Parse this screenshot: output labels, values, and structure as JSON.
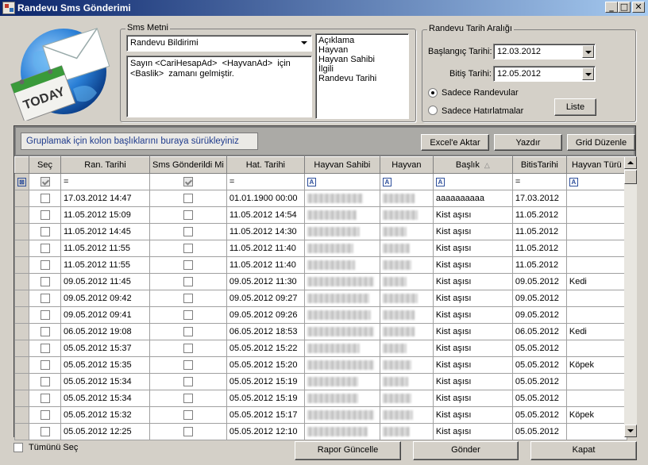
{
  "window": {
    "title": "Randevu Sms Gönderimi"
  },
  "sms": {
    "group_title": "Sms Metni",
    "template_selected": "Randevu Bildirimi",
    "message_text": "Sayın <CariHesapAd>  <HayvanAd>  için <Baslik>  zamanı gelmiştir.",
    "fields": [
      "Açıklama",
      "Hayvan",
      "Hayvan Sahibi",
      "İlgili",
      "Randevu Tarihi"
    ]
  },
  "date_range": {
    "group_title": "Randevu Tarih Aralığı",
    "start_label": "Başlangıç Tarihi:",
    "start_value": "12.03.2012",
    "end_label": "Bitiş Tarihi:",
    "end_value": "12.05.2012",
    "radio_appointments": "Sadece Randevular",
    "radio_reminders": "Sadece Hatırlatmalar",
    "selected": "appointments",
    "list_button": "Liste"
  },
  "toolbar": {
    "group_hint": "Gruplamak için kolon başlıklarını buraya sürükleyiniz",
    "excel_button": "Excel'e Aktar",
    "print_button": "Yazdır",
    "grid_button": "Grid Düzenle"
  },
  "grid": {
    "columns": [
      "Seç",
      "Ran. Tarihi",
      "Sms Gönderildi Mi",
      "Hat. Tarihi",
      "Hayvan Sahibi",
      "Hayvan",
      "Başlık",
      "BitisTarihi",
      "Hayvan Türü"
    ],
    "filter_ops": [
      "=",
      "=",
      "=",
      "=",
      "=",
      "=",
      "=",
      "=",
      "="
    ],
    "rows": [
      {
        "ran": "17.03.2012 14:47",
        "hat": "01.01.1900 00:00",
        "baslik": "aaaaaaaaaa",
        "bitis": "17.03.2012",
        "tur": ""
      },
      {
        "ran": "11.05.2012 15:09",
        "hat": "11.05.2012 14:54",
        "baslik": "Kist aşısı",
        "bitis": "11.05.2012",
        "tur": ""
      },
      {
        "ran": "11.05.2012 14:45",
        "hat": "11.05.2012 14:30",
        "baslik": "Kist aşısı",
        "bitis": "11.05.2012",
        "tur": ""
      },
      {
        "ran": "11.05.2012 11:55",
        "hat": "11.05.2012 11:40",
        "baslik": "Kist aşısı",
        "bitis": "11.05.2012",
        "tur": ""
      },
      {
        "ran": "11.05.2012 11:55",
        "hat": "11.05.2012 11:40",
        "baslik": "Kist aşısı",
        "bitis": "11.05.2012",
        "tur": ""
      },
      {
        "ran": "09.05.2012 11:45",
        "hat": "09.05.2012 11:30",
        "baslik": "Kist aşısı",
        "bitis": "09.05.2012",
        "tur": "Kedi"
      },
      {
        "ran": "09.05.2012 09:42",
        "hat": "09.05.2012 09:27",
        "baslik": "Kist aşısı",
        "bitis": "09.05.2012",
        "tur": ""
      },
      {
        "ran": "09.05.2012 09:41",
        "hat": "09.05.2012 09:26",
        "baslik": "Kist aşısı",
        "bitis": "09.05.2012",
        "tur": ""
      },
      {
        "ran": "06.05.2012 19:08",
        "hat": "06.05.2012 18:53",
        "baslik": "Kist aşısı",
        "bitis": "06.05.2012",
        "tur": "Kedi"
      },
      {
        "ran": "05.05.2012 15:37",
        "hat": "05.05.2012 15:22",
        "baslik": "Kist aşısı",
        "bitis": "05.05.2012",
        "tur": ""
      },
      {
        "ran": "05.05.2012 15:35",
        "hat": "05.05.2012 15:20",
        "baslik": "Kist aşısı",
        "bitis": "05.05.2012",
        "tur": "Köpek"
      },
      {
        "ran": "05.05.2012 15:34",
        "hat": "05.05.2012 15:19",
        "baslik": "Kist aşısı",
        "bitis": "05.05.2012",
        "tur": ""
      },
      {
        "ran": "05.05.2012 15:34",
        "hat": "05.05.2012 15:19",
        "baslik": "Kist aşısı",
        "bitis": "05.05.2012",
        "tur": ""
      },
      {
        "ran": "05.05.2012 15:32",
        "hat": "05.05.2012 15:17",
        "baslik": "Kist aşısı",
        "bitis": "05.05.2012",
        "tur": "Köpek"
      },
      {
        "ran": "05.05.2012 12:25",
        "hat": "05.05.2012 12:10",
        "baslik": "Kist aşısı",
        "bitis": "05.05.2012",
        "tur": ""
      }
    ]
  },
  "footer": {
    "select_all": "Tümünü Seç",
    "refresh_button": "Rapor Güncelle",
    "send_button": "Gönder",
    "close_button": "Kapat"
  },
  "logo": {
    "text": "TODAY"
  }
}
